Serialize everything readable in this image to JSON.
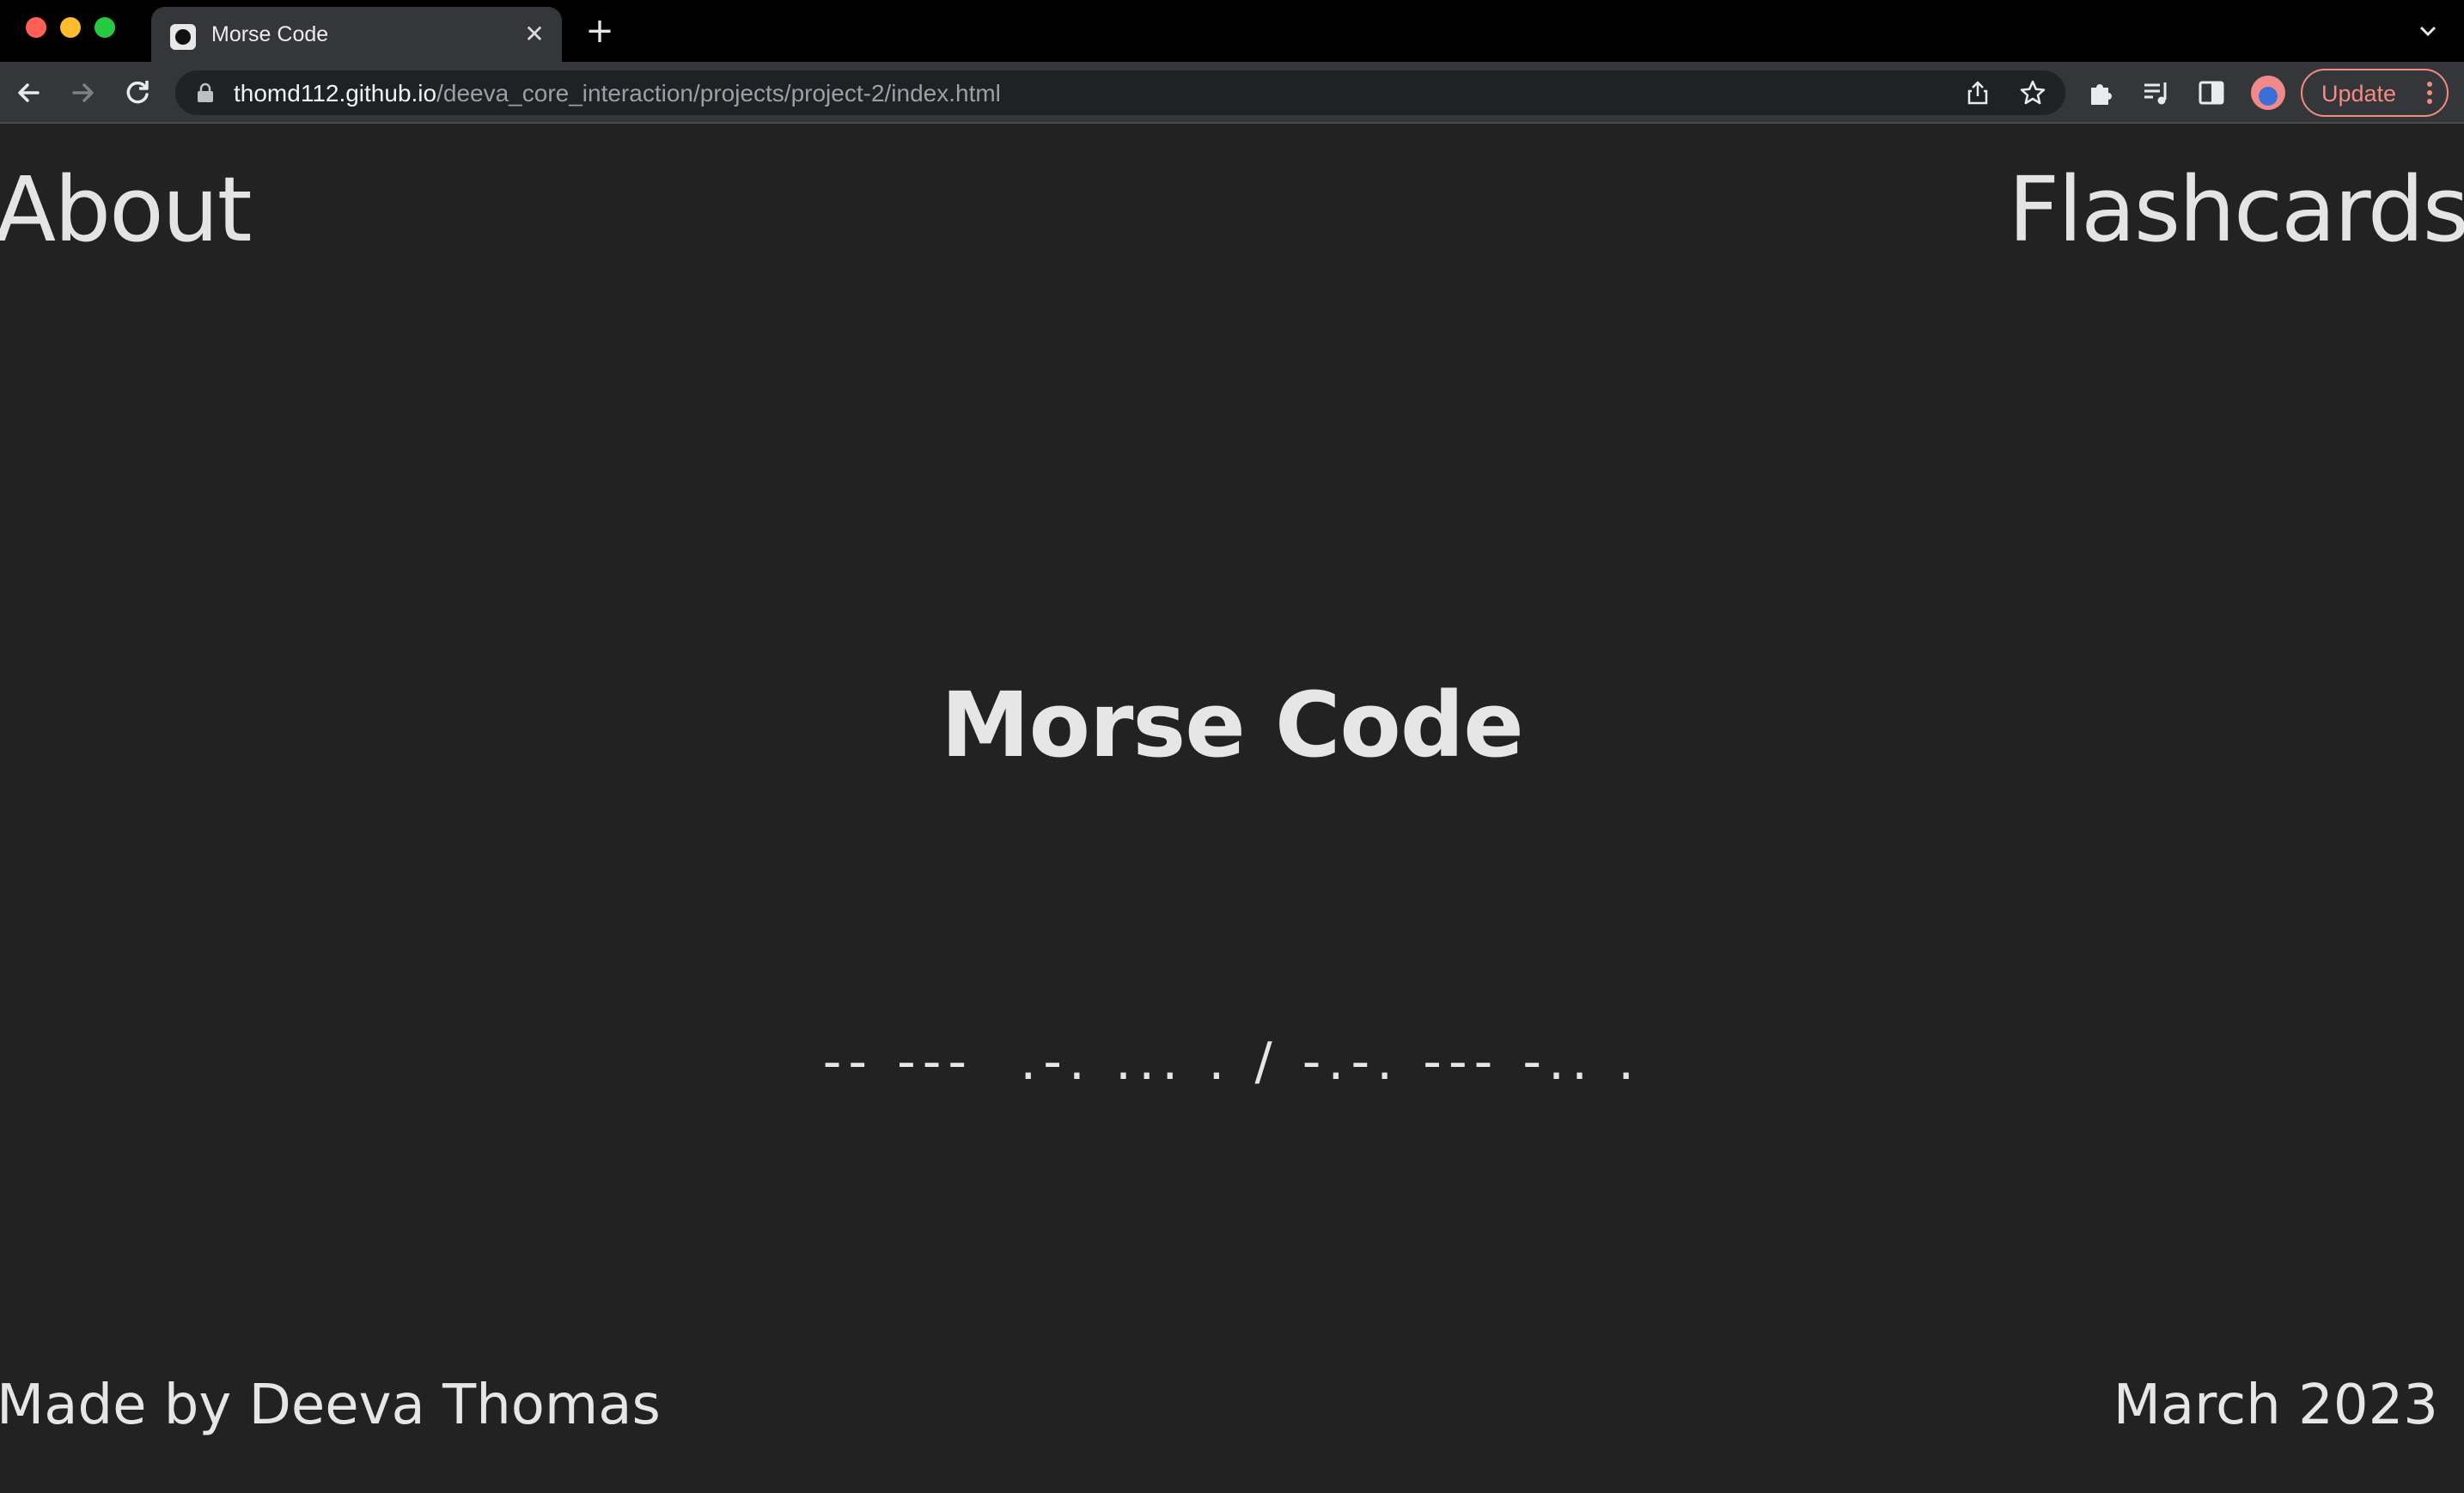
{
  "browser": {
    "tab": {
      "title": "Morse Code",
      "close": "✕"
    },
    "new_tab": "+",
    "url": {
      "host": "thomd112.github.io",
      "path": "/deeva_core_interaction/projects/project-2/index.html"
    },
    "update_label": "Update"
  },
  "page": {
    "nav": {
      "about": "About",
      "flashcards": "Flashcards"
    },
    "title": "Morse Code",
    "morse": "-- ---  .-. ... . / -.-. --- -.. .",
    "footer": {
      "credit": "Made by Deeva Thomas",
      "date": "March 2023"
    }
  }
}
